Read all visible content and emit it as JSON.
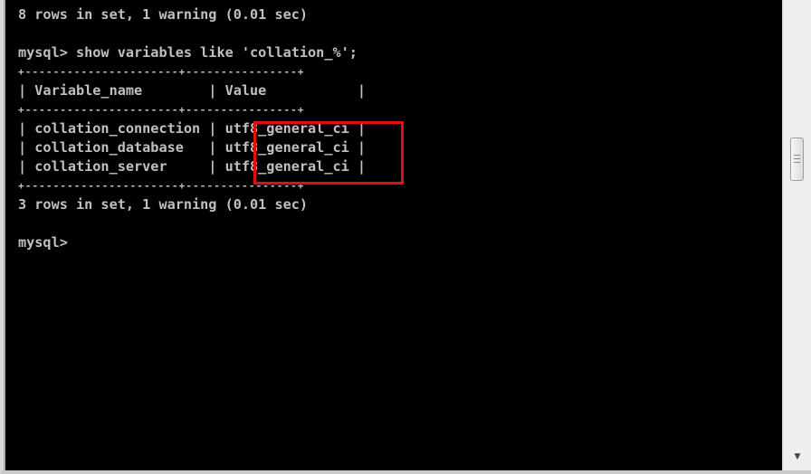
{
  "console": {
    "lines": [
      {
        "kind": "text",
        "text": "8 rows in set, 1 warning (0.01 sec)"
      },
      {
        "kind": "text",
        "text": ""
      },
      {
        "kind": "text",
        "text": "mysql> show variables like 'collation_%';"
      },
      {
        "kind": "sep",
        "text": "+----------------------+----------------+"
      },
      {
        "kind": "text",
        "text": "| Variable_name        | Value           |"
      },
      {
        "kind": "sep",
        "text": "+----------------------+----------------+"
      },
      {
        "kind": "text",
        "text": "| collation_connection | utf8_general_ci |"
      },
      {
        "kind": "text",
        "text": "| collation_database   | utf8_general_ci |"
      },
      {
        "kind": "text",
        "text": "| collation_server     | utf8_general_ci |"
      },
      {
        "kind": "sep",
        "text": "+----------------------+----------------+"
      },
      {
        "kind": "text",
        "text": "3 rows in set, 1 warning (0.01 sec)"
      },
      {
        "kind": "text",
        "text": ""
      },
      {
        "kind": "text",
        "text": "mysql>"
      }
    ],
    "text_color": "#c0c0c0",
    "background_color": "#000000",
    "highlight_color": "#e01010"
  },
  "scrollbar": {
    "down_arrow_icon": "down-arrow-icon"
  }
}
